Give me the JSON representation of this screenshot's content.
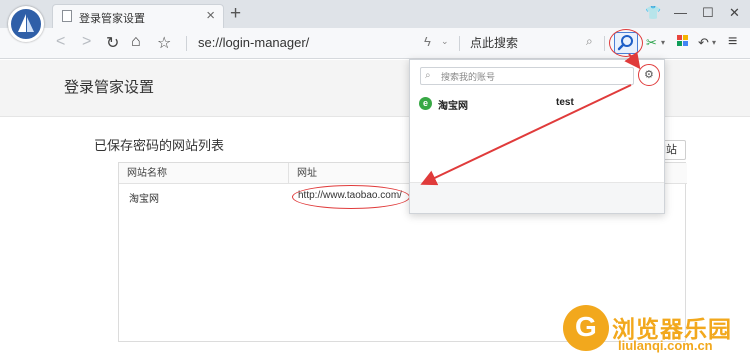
{
  "tab": {
    "title": "登录管家设置",
    "close": "×"
  },
  "new_tab": "+",
  "window_controls": {
    "skin": "👕",
    "minimize": "—",
    "maximize": "☐",
    "close": "✕"
  },
  "nav": {
    "back": "<",
    "forward": ">",
    "reload": "↻",
    "home": "⌂",
    "favorite": "☆"
  },
  "address_bar": {
    "url": "se://login-manager/"
  },
  "search_box": {
    "placeholder": "点此搜索"
  },
  "extensions": {
    "scissors": "✂",
    "undo": "↶",
    "menu": "≡"
  },
  "page": {
    "title": "登录管家设置",
    "list_title": "已保存密码的网站列表",
    "add_button": "网站"
  },
  "table": {
    "columns": [
      "网站名称",
      "网址"
    ],
    "rows": [
      {
        "name": "淘宝网",
        "url": "http://www.taobao.com/"
      }
    ]
  },
  "popup": {
    "search_placeholder": "搜索我的账号",
    "accounts": [
      {
        "site": "淘宝网",
        "user": "test",
        "icon": "e"
      }
    ]
  },
  "watermark": {
    "title": "浏览器乐园",
    "url": "liulanqi.com.cn",
    "letter": "G"
  },
  "colors": {
    "annotation_red": "#e03b3b",
    "watermark_orange": "#f2a81d",
    "browser_accent": "#2f5fa8"
  }
}
